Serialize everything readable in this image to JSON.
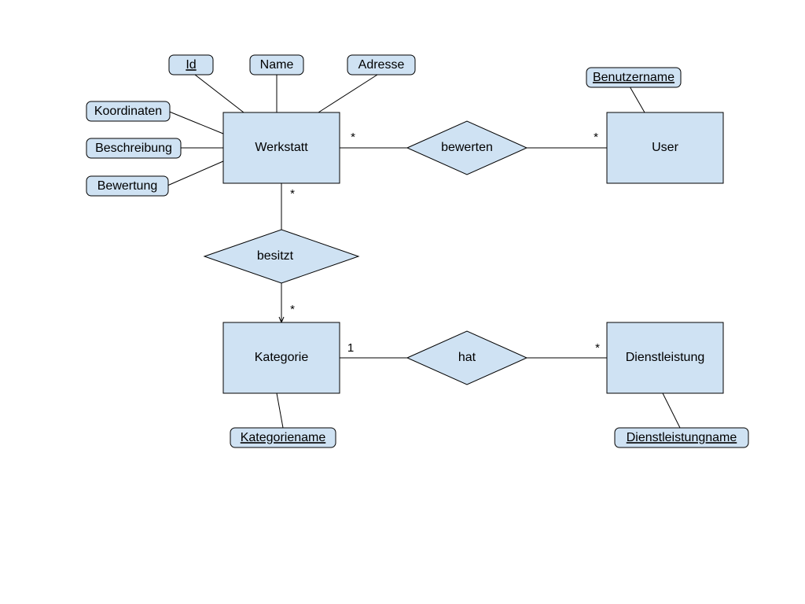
{
  "entities": {
    "werkstatt": "Werkstatt",
    "user": "User",
    "kategorie": "Kategorie",
    "dienstleistung": "Dienstleistung"
  },
  "relations": {
    "bewerten": "bewerten",
    "besitzt": "besitzt",
    "hat": "hat"
  },
  "attributes": {
    "id": "Id",
    "name": "Name",
    "adresse": "Adresse",
    "koordinaten": "Koordinaten",
    "beschreibung": "Beschreibung",
    "bewertung": "Bewertung",
    "benutzername": "Benutzername",
    "kategoriename": "Kategoriename",
    "dienstleistungname": "Dienstleistungname"
  },
  "cardinalities": {
    "werkstatt_bewerten": "*",
    "user_bewerten": "*",
    "werkstatt_besitzt": "*",
    "kategorie_besitzt": "*",
    "kategorie_hat": "1",
    "dienstleistung_hat": "*"
  }
}
